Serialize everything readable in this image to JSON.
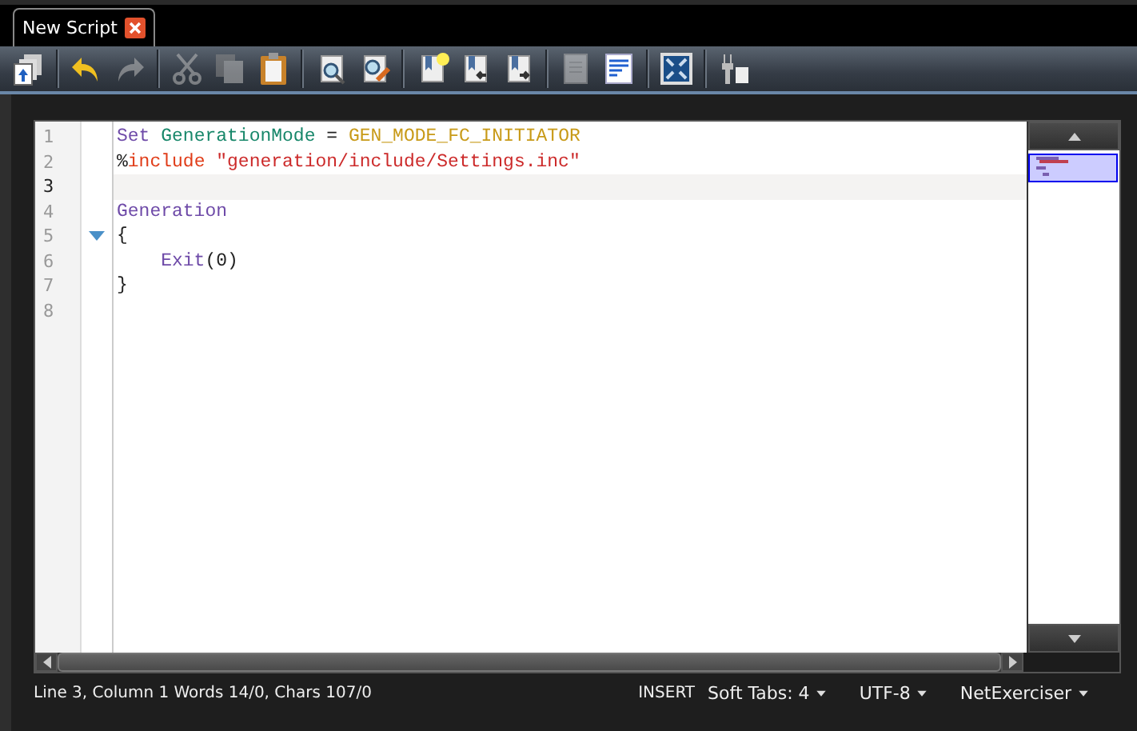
{
  "tabs": [
    {
      "label": "New Script",
      "selected": true,
      "closable": true
    }
  ],
  "toolbar": [
    {
      "disabled": false
    },
    {
      "disabled": false
    },
    {
      "disabled": true
    },
    {
      "disabled": true
    },
    {
      "disabled": true
    },
    {
      "disabled": false
    },
    {
      "disabled": false
    },
    {
      "disabled": false
    },
    {
      "disabled": false
    },
    {
      "disabled": false
    },
    {
      "disabled": false
    },
    {
      "disabled": true
    },
    {
      "disabled": false
    },
    {
      "disabled": false
    },
    {
      "disabled": false
    }
  ],
  "editor": {
    "lines": [
      {
        "number": "1",
        "current": false,
        "tokens": [
          {
            "kind": "keyword",
            "text": "Set "
          },
          {
            "kind": "identifier",
            "text": "GenerationMode"
          },
          {
            "kind": "plain",
            "text": " = "
          },
          {
            "kind": "constant",
            "text": "GEN_MODE_FC_INITIATOR"
          }
        ]
      },
      {
        "number": "2",
        "current": false,
        "tokens": [
          {
            "kind": "plain",
            "text": "%"
          },
          {
            "kind": "directive",
            "text": "include "
          },
          {
            "kind": "string",
            "text": "\"generation/include/Settings.inc\""
          }
        ]
      },
      {
        "number": "3",
        "current": true
      },
      {
        "number": "4",
        "current": false,
        "tokens": [
          {
            "kind": "keyword",
            "text": "Generation"
          }
        ]
      },
      {
        "number": "5",
        "current": false,
        "foldable": true,
        "expanded": true,
        "tokens": [
          {
            "kind": "plain",
            "text": "{"
          }
        ]
      },
      {
        "number": "6",
        "current": false,
        "indented": true,
        "tokens": [
          {
            "kind": "keyword",
            "text": "Exit"
          },
          {
            "kind": "plain",
            "text": "(0)"
          }
        ]
      },
      {
        "number": "7",
        "current": false,
        "tokens": [
          {
            "kind": "plain",
            "text": "}"
          }
        ]
      },
      {
        "number": "8",
        "current": false
      }
    ]
  },
  "status_bar": {
    "position": "Line 3, Column 1 Words 14/0, Chars 107/0",
    "mode": "INSERT",
    "menus": [
      "Soft Tabs: 4",
      "UTF-8",
      "NetExerciser"
    ]
  }
}
